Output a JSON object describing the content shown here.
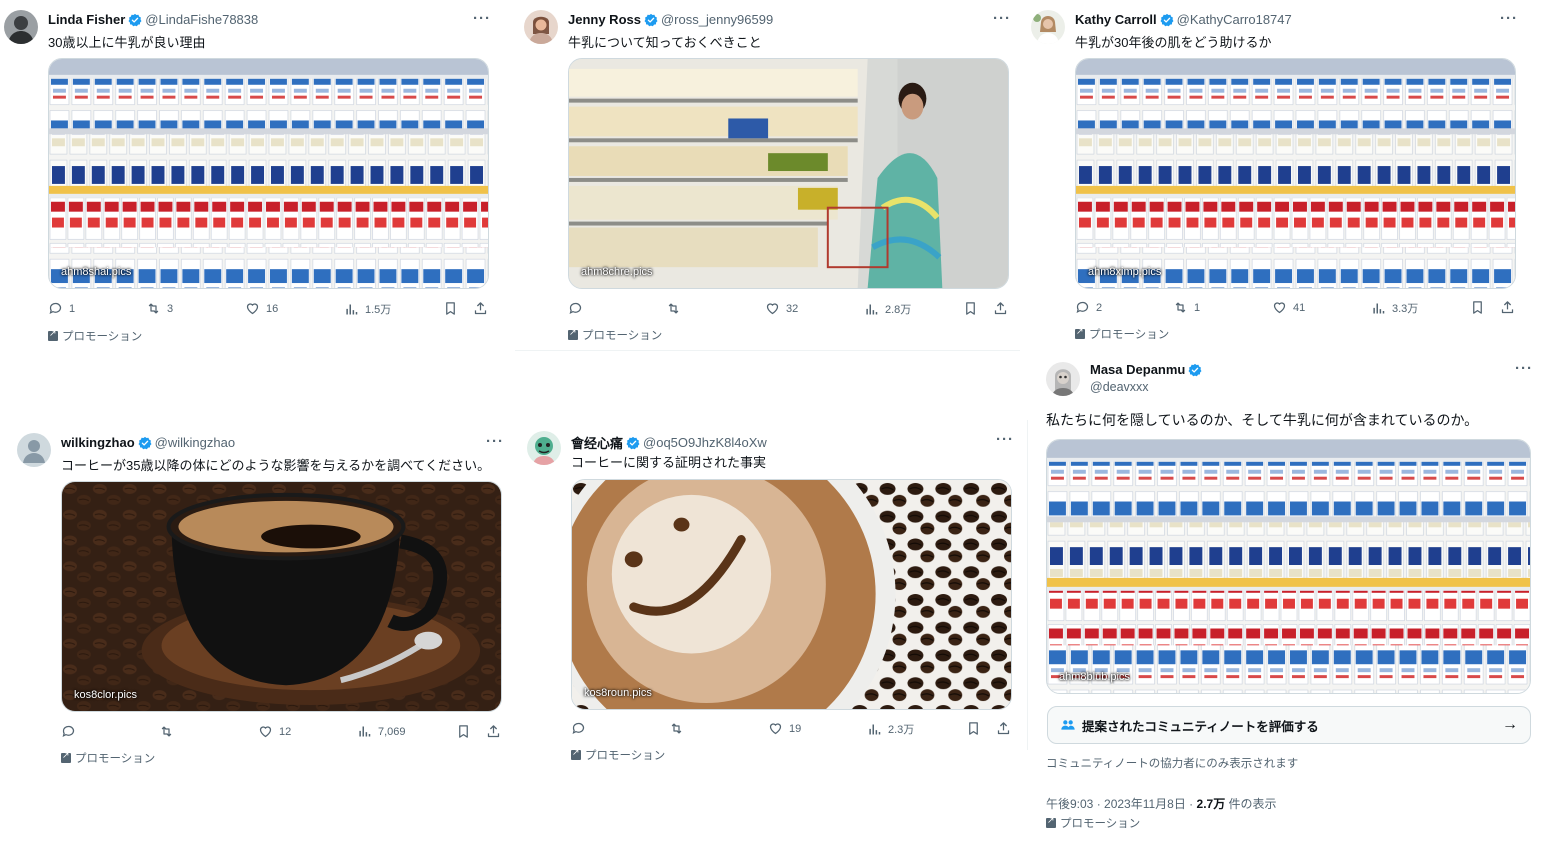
{
  "tweets": [
    {
      "name": "Linda Fisher",
      "handle": "@LindaFishe78838",
      "text": "30歳以上に牛乳が良い理由",
      "media_label": "ahm8shai.pics",
      "replies": "1",
      "reposts": "3",
      "likes": "16",
      "views": "1.5万",
      "promo": "プロモーション"
    },
    {
      "name": "Jenny Ross",
      "handle": "@ross_jenny96599",
      "text": "牛乳について知っておくべきこと",
      "media_label": "ahm8chre.pics",
      "replies": "",
      "reposts": "",
      "likes": "32",
      "views": "2.8万",
      "promo": "プロモーション"
    },
    {
      "name": "Kathy Carroll",
      "handle": "@KathyCarro18747",
      "text": "牛乳が30年後の肌をどう助けるか",
      "media_label": "ahm8ximp.pics",
      "replies": "2",
      "reposts": "1",
      "likes": "41",
      "views": "3.3万",
      "promo": "プロモーション"
    },
    {
      "name": "wilkingzhao",
      "handle": "@wilkingzhao",
      "text": "コーヒーが35歳以降の体にどのような影響を与えるかを調べてください。",
      "media_label": "kos8clor.pics",
      "replies": "",
      "reposts": "",
      "likes": "12",
      "views": "7,069",
      "promo": "プロモーション"
    },
    {
      "name": "會经心痛",
      "handle": "@oq5O9JhzK8l4oXw",
      "text": "コーヒーに関する証明された事実",
      "media_label": "kos8roun.pics",
      "replies": "",
      "reposts": "",
      "likes": "19",
      "views": "2.3万",
      "promo": "プロモーション"
    },
    {
      "name": "Masa Depanmu",
      "handle": "@deavxxx",
      "text": "私たちに何を隠しているのか、そして牛乳に何が含まれているのか。",
      "media_label": "ahm8blub.pics",
      "community_note_button": "提案されたコミュニティノートを評価する",
      "community_note_hint": "コミュニティノートの協力者にのみ表示されます",
      "timestamp": "午後9:03 · 2023年11月8日 · ",
      "view_count": "2.7万",
      "view_suffix": " 件の表示",
      "promo": "プロモーション"
    }
  ],
  "colors": {
    "verified": "#1d9bf0",
    "secondary_text": "#536471",
    "primary_text": "#0f1419",
    "border": "#cfd9de"
  },
  "icons": [
    "verified-badge-icon",
    "more-icon",
    "reply-icon",
    "repost-icon",
    "like-icon",
    "views-icon",
    "bookmark-icon",
    "share-icon",
    "promoted-icon",
    "community-notes-icon",
    "arrow-right-icon"
  ]
}
